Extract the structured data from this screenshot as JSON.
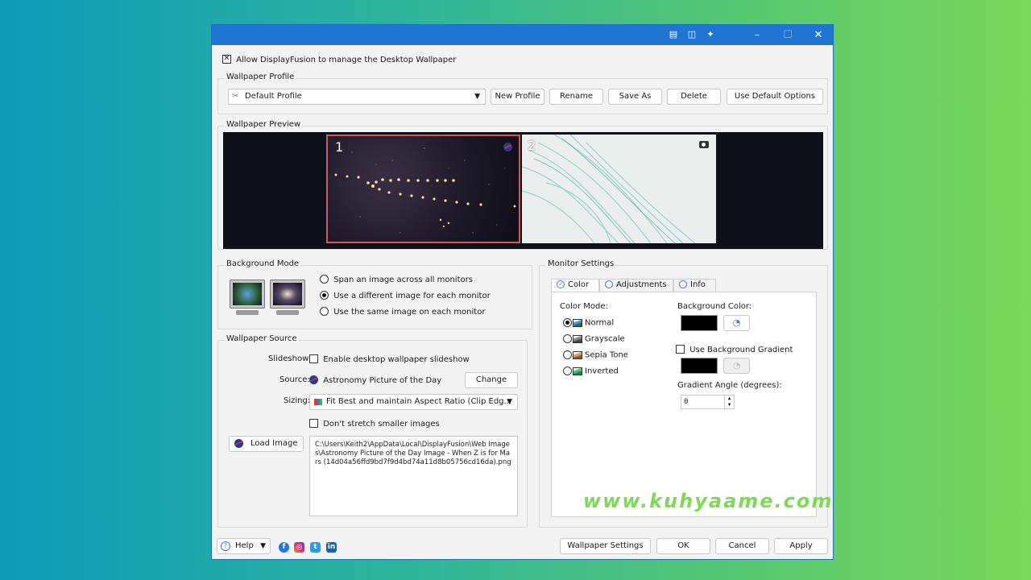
{
  "window": {
    "allow_label": "Allow DisplayFusion to manage the Desktop Wallpaper",
    "allow_checked": true
  },
  "wallpaper_profile": {
    "title": "Wallpaper Profile",
    "selected_profile": "Default Profile",
    "buttons": {
      "new_profile": "New Profile",
      "rename": "Rename",
      "save_as": "Save As",
      "delete": "Delete",
      "use_default": "Use Default Options"
    }
  },
  "wallpaper_preview": {
    "title": "Wallpaper Preview",
    "monitors": [
      {
        "number": "1"
      },
      {
        "number": "2"
      }
    ]
  },
  "background_mode": {
    "title": "Background Mode",
    "options": [
      {
        "label": "Span an image across all monitors",
        "checked": false
      },
      {
        "label": "Use a different image for each monitor",
        "checked": true
      },
      {
        "label": "Use the same image on each monitor",
        "checked": false
      }
    ]
  },
  "wallpaper_source": {
    "title": "Wallpaper Source",
    "slideshow_label": "Slideshow:",
    "slideshow_checkbox": "Enable desktop wallpaper slideshow",
    "source_label": "Source:",
    "source_value": "Astronomy Picture of the Day",
    "change_button": "Change",
    "sizing_label": "Sizing:",
    "sizing_value": "Fit Best and maintain Aspect Ratio (Clip Edg...",
    "no_stretch_label": "Don't stretch smaller images",
    "load_image_button": "Load Image",
    "file_path": "C:\\Users\\Keith2\\AppData\\Local\\DisplayFusion\\Web Images\\Astronomy Picture of the Day Image - When Z is for Mars (14d04a56ffd9bd7f9d4bd74a11d8b05756cd16da).png"
  },
  "monitor_settings": {
    "title": "Monitor Settings",
    "tabs": [
      {
        "label": "Color",
        "active": true
      },
      {
        "label": "Adjustments",
        "active": false
      },
      {
        "label": "Info",
        "active": false
      }
    ],
    "color_mode_label": "Color Mode:",
    "color_modes": [
      {
        "label": "Normal",
        "checked": true
      },
      {
        "label": "Grayscale",
        "checked": false
      },
      {
        "label": "Sepia Tone",
        "checked": false
      },
      {
        "label": "Inverted",
        "checked": false
      }
    ],
    "background_color_label": "Background Color:",
    "background_color": "#000000",
    "use_gradient_label": "Use Background Gradient",
    "gradient_color": "#000000",
    "gradient_angle_label": "Gradient Angle (degrees):",
    "gradient_angle_value": "0"
  },
  "footer": {
    "help_label": "Help",
    "wallpaper_settings": "Wallpaper Settings",
    "ok": "OK",
    "cancel": "Cancel",
    "apply": "Apply"
  },
  "watermark": "www.kuhyaame.com"
}
